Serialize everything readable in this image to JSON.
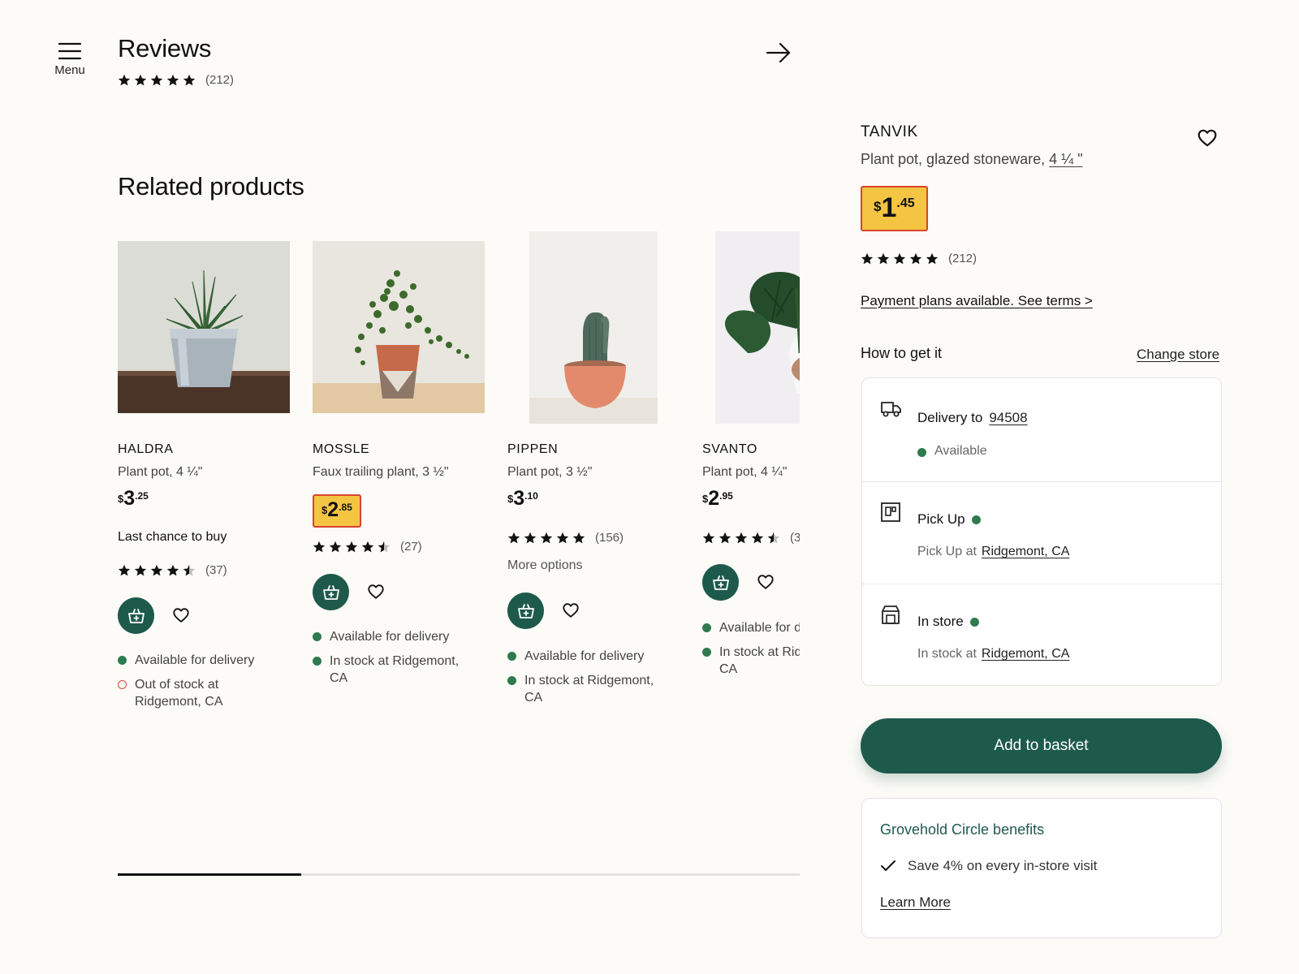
{
  "header": {
    "menu_label": "Menu",
    "reviews_title": "Reviews",
    "reviews_rating": 5,
    "reviews_count": "(212)"
  },
  "related": {
    "title": "Related products",
    "products": [
      {
        "name": "HALDRA",
        "desc": "Plant pot, 4 ¼\"",
        "price": {
          "currency": "$",
          "int": "3",
          "dec": ".25"
        },
        "highlighted": false,
        "note": "Last chance to buy",
        "rating": 4.5,
        "count": "(37)",
        "availability": [
          {
            "status": "available",
            "text": "Available for delivery"
          },
          {
            "status": "out",
            "text": "Out of stock at Ridgemont, CA"
          }
        ]
      },
      {
        "name": "MOSSLE",
        "desc": "Faux trailing plant, 3 ½\"",
        "price": {
          "currency": "$",
          "int": "2",
          "dec": ".85"
        },
        "highlighted": true,
        "note": "",
        "rating": 4.5,
        "count": "(27)",
        "availability": [
          {
            "status": "available",
            "text": "Available for delivery"
          },
          {
            "status": "available",
            "text": "In stock at Ridgemont, CA"
          }
        ]
      },
      {
        "name": "PIPPEN",
        "desc": "Plant pot, 3 ½\"",
        "price": {
          "currency": "$",
          "int": "3",
          "dec": ".10"
        },
        "highlighted": false,
        "note": "More options",
        "rating": 5,
        "count": "(156)",
        "availability": [
          {
            "status": "available",
            "text": "Available for delivery"
          },
          {
            "status": "available",
            "text": "In stock at Ridgemont, CA"
          }
        ]
      },
      {
        "name": "SVANTO",
        "desc": "Plant pot, 4 ¼\"",
        "price": {
          "currency": "$",
          "int": "2",
          "dec": ".95"
        },
        "highlighted": false,
        "note": "",
        "rating": 4.5,
        "count": "(3",
        "availability": [
          {
            "status": "available",
            "text": "Available for delivery"
          },
          {
            "status": "available",
            "text": "In stock at Ridgemont, CA"
          }
        ]
      }
    ],
    "carousel_progress": 0.27
  },
  "panel": {
    "name": "TANVIK",
    "desc": "Plant pot, glazed stoneware,",
    "desc_size": "4 ¼ \"",
    "price": {
      "currency": "$",
      "int": "1",
      "dec": ".45"
    },
    "rating": 5,
    "count": "(212)",
    "payment_link": "Payment plans available. See terms >",
    "how_to_get": "How to get it",
    "change_store": "Change store",
    "delivery": {
      "label": "Delivery to",
      "zip": "94508",
      "status": "Available"
    },
    "pickup": {
      "label": "Pick Up",
      "sub_prefix": "Pick Up at",
      "store": "Ridgemont, CA"
    },
    "instore": {
      "label": "In store",
      "sub_prefix": "In stock at",
      "store": "Ridgemont, CA"
    },
    "add_to_basket": "Add to basket",
    "benefits": {
      "title": "Grovehold Circle benefits",
      "item": "Save 4% on every in-store visit",
      "learn_more": "Learn More"
    }
  },
  "colors": {
    "primary": "#1e5a4c",
    "price_highlight": "#f4c542",
    "price_border": "#d9442c",
    "available": "#2f7a4f",
    "out_of_stock": "#d04a38",
    "background": "#fcfbf7"
  }
}
